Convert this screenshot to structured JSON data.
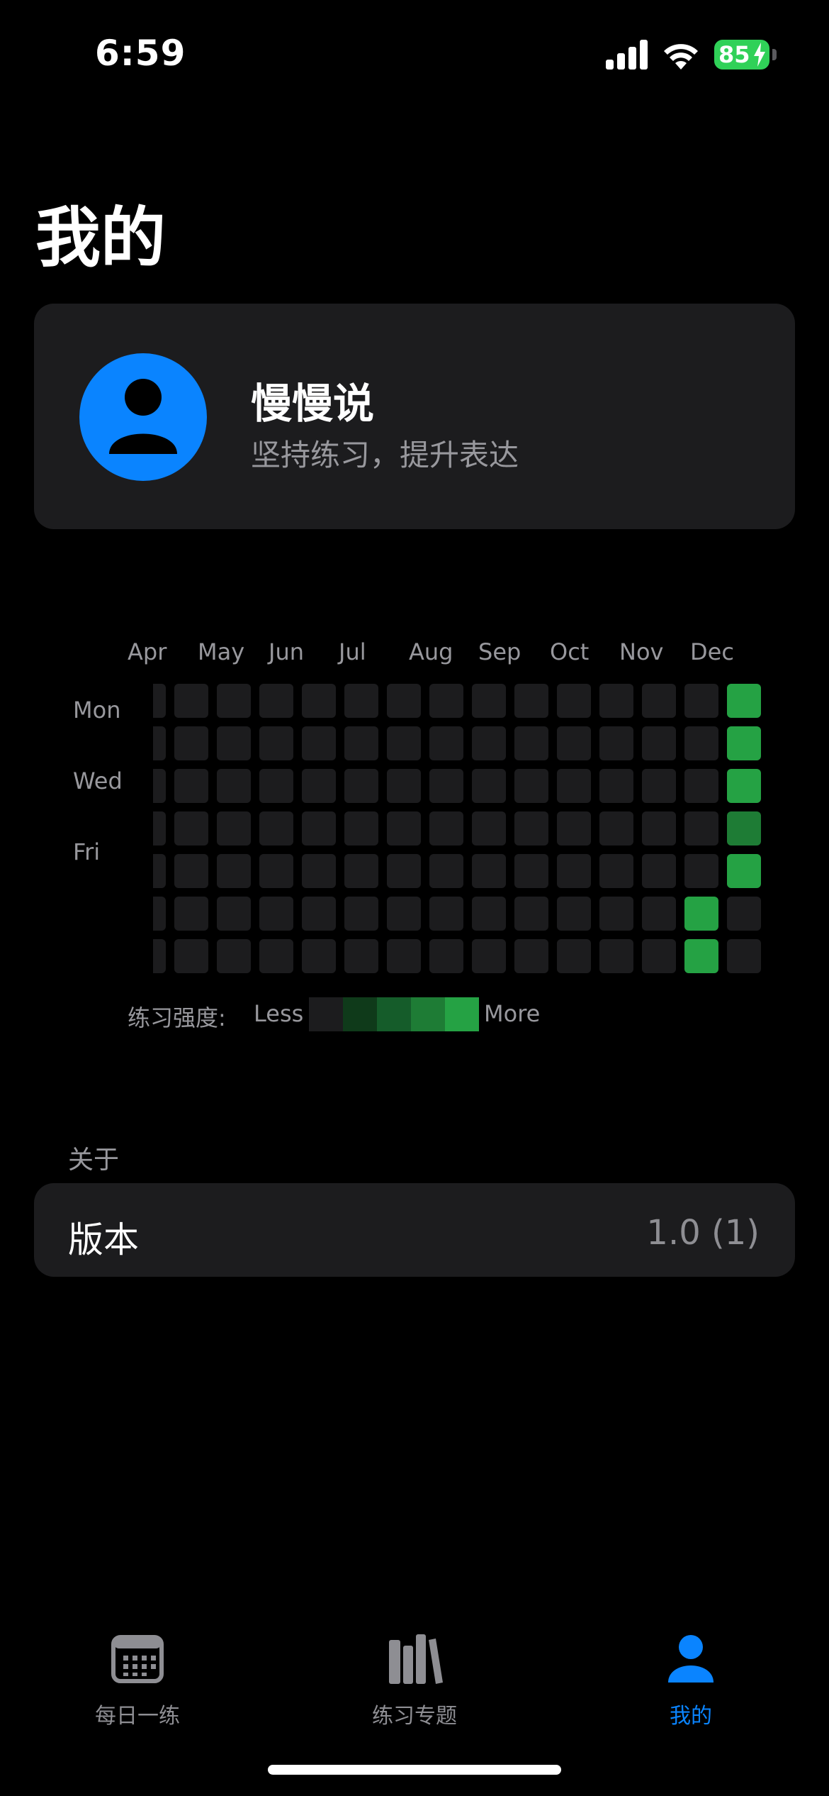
{
  "status_bar": {
    "time": "6:59",
    "battery_level": "85",
    "battery_color": "#30d158",
    "icons": [
      "cellular-signal-icon",
      "wifi-icon",
      "battery-charging-icon"
    ]
  },
  "page": {
    "title": "我的"
  },
  "profile": {
    "name": "慢慢说",
    "subtitle": "坚持练习，提升表达",
    "avatar_icon": "person-icon",
    "avatar_color": "#0a84ff"
  },
  "heatmap": {
    "months": [
      "Apr",
      "May",
      "Jun",
      "Jul",
      "Aug",
      "Sep",
      "Oct",
      "Nov",
      "Dec"
    ],
    "day_labels": [
      "Mon",
      "Wed",
      "Fri"
    ],
    "columns": 15,
    "rows": 7,
    "colors": {
      "0": "#1c1c1e",
      "1": "#0f3a1a",
      "2": "#155c2a",
      "3": "#1e7c35",
      "4": "#25a244"
    },
    "active_cells": [
      {
        "col": 14,
        "row": 0,
        "level": 4
      },
      {
        "col": 14,
        "row": 1,
        "level": 4
      },
      {
        "col": 14,
        "row": 2,
        "level": 4
      },
      {
        "col": 14,
        "row": 3,
        "level": 3
      },
      {
        "col": 14,
        "row": 4,
        "level": 4
      },
      {
        "col": 13,
        "row": 5,
        "level": 4
      },
      {
        "col": 13,
        "row": 6,
        "level": 4
      }
    ],
    "legend": {
      "title": "练习强度:",
      "less": "Less",
      "more": "More"
    }
  },
  "about": {
    "header": "关于",
    "version_label": "版本",
    "version_value": "1.0 (1)"
  },
  "tab_bar": {
    "tabs": [
      {
        "label": "每日一练",
        "icon": "calendar-icon",
        "selected": false
      },
      {
        "label": "练习专题",
        "icon": "books-icon",
        "selected": false
      },
      {
        "label": "我的",
        "icon": "person-icon",
        "selected": true
      }
    ],
    "active_color": "#0a84ff",
    "inactive_color": "#8e8e93"
  }
}
